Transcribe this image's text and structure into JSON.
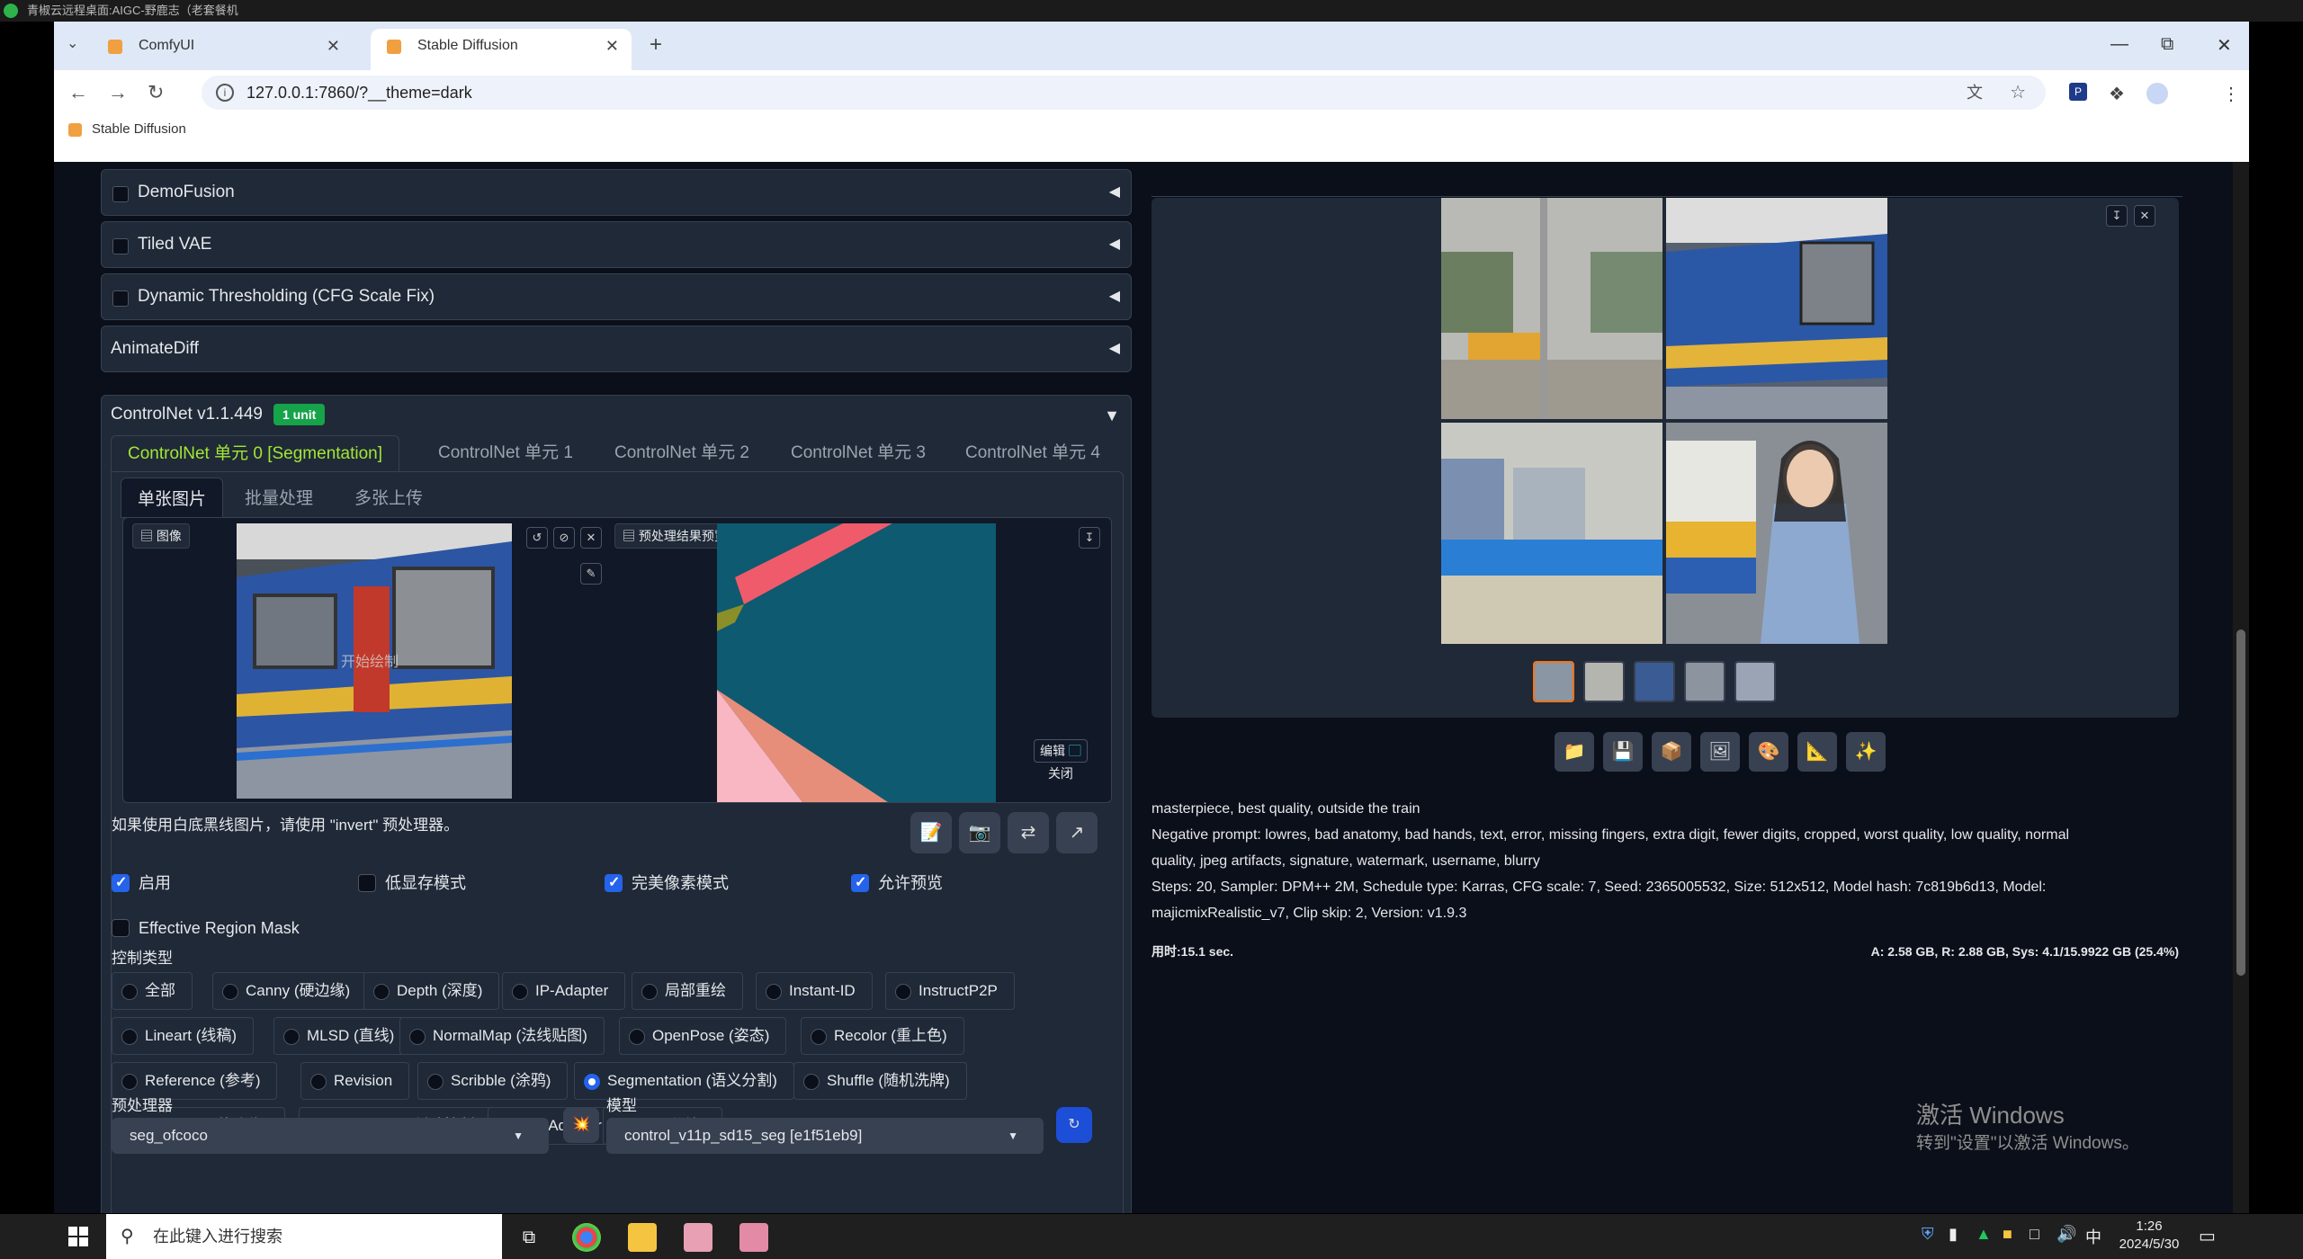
{
  "window": {
    "title": "青椒云远程桌面:AIGC-野鹿志（老套餐机"
  },
  "tabs": [
    {
      "label": "ComfyUI"
    },
    {
      "label": "Stable Diffusion"
    }
  ],
  "url": "127.0.0.1:7860/?__theme=dark",
  "bookmarks": [
    {
      "label": "Stable Diffusion"
    }
  ],
  "accordions": [
    {
      "label": "DemoFusion"
    },
    {
      "label": "Tiled VAE"
    },
    {
      "label": "Dynamic Thresholding (CFG Scale Fix)"
    },
    {
      "label": "AnimateDiff"
    }
  ],
  "controlnet": {
    "title": "ControlNet v1.1.449",
    "badge": "1 unit",
    "unit_tabs": [
      "ControlNet 单元 0 [Segmentation]",
      "ControlNet 单元 1",
      "ControlNet 单元 2",
      "ControlNet 单元 3",
      "ControlNet 单元 4"
    ],
    "image_tabs": [
      "单张图片",
      "批量处理",
      "多张上传"
    ],
    "image_label": "图像",
    "draw_hint": "开始绘制",
    "preview_label": "预处理结果预览",
    "edit_label": "编辑",
    "close_label": "关闭",
    "invert_hint": "如果使用白底黑线图片，请使用 \"invert\" 预处理器。",
    "checkboxes": [
      {
        "label": "启用",
        "checked": true
      },
      {
        "label": "低显存模式",
        "checked": false
      },
      {
        "label": "完美像素模式",
        "checked": true
      },
      {
        "label": "允许预览",
        "checked": true
      }
    ],
    "region_mask": "Effective Region Mask",
    "control_type_label": "控制类型",
    "control_types": [
      [
        "全部",
        "Canny (硬边缘)",
        "Depth (深度)",
        "IP-Adapter",
        "局部重绘",
        "Instant-ID",
        "InstructP2P"
      ],
      [
        "Lineart (线稿)",
        "MLSD (直线)",
        "NormalMap (法线贴图)",
        "OpenPose (姿态)",
        "Recolor (重上色)"
      ],
      [
        "Reference (参考)",
        "Revision",
        "Scribble (涂鸦)",
        "Segmentation (语义分割)",
        "Shuffle (随机洗牌)"
      ],
      [
        "SoftEdge (软边缘)",
        "SparseCtrl (稀疏控制)",
        "T2I-Adapter",
        "Tile (分块)"
      ]
    ],
    "selected_type": "Segmentation (语义分割)",
    "preprocessor_label": "预处理器",
    "preprocessor_value": "seg_ofcoco",
    "model_label": "模型",
    "model_value": "control_v11p_sd15_seg [e1f51eb9]"
  },
  "output": {
    "prompt": "masterpiece, best quality, outside the train",
    "negative": "Negative prompt: lowres, bad anatomy, bad hands, text, error, missing fingers, extra digit, fewer digits, cropped, worst quality, low quality, normal",
    "negative2": "quality, jpeg artifacts, signature, watermark, username, blurry",
    "params": "Steps: 20, Sampler: DPM++ 2M, Schedule type: Karras, CFG scale: 7, Seed: 2365005532, Size: 512x512, Model hash: 7c819b6d13, Model:",
    "params2": "majicmixRealistic_v7, Clip skip: 2, Version: v1.9.3",
    "time": "用时:15.1 sec.",
    "mem": "A: 2.58 GB, R: 2.88 GB, Sys: 4.1/15.9922 GB (25.4%)"
  },
  "watermark": {
    "line1": "激活 Windows",
    "line2": "转到\"设置\"以激活 Windows。"
  },
  "taskbar": {
    "search_placeholder": "在此键入进行搜索",
    "time": "1:26",
    "date": "2024/5/30",
    "ime": "中"
  },
  "colors": {
    "accent": "#a3e635",
    "bg": "#0b0f19",
    "panel": "#1f2937"
  }
}
